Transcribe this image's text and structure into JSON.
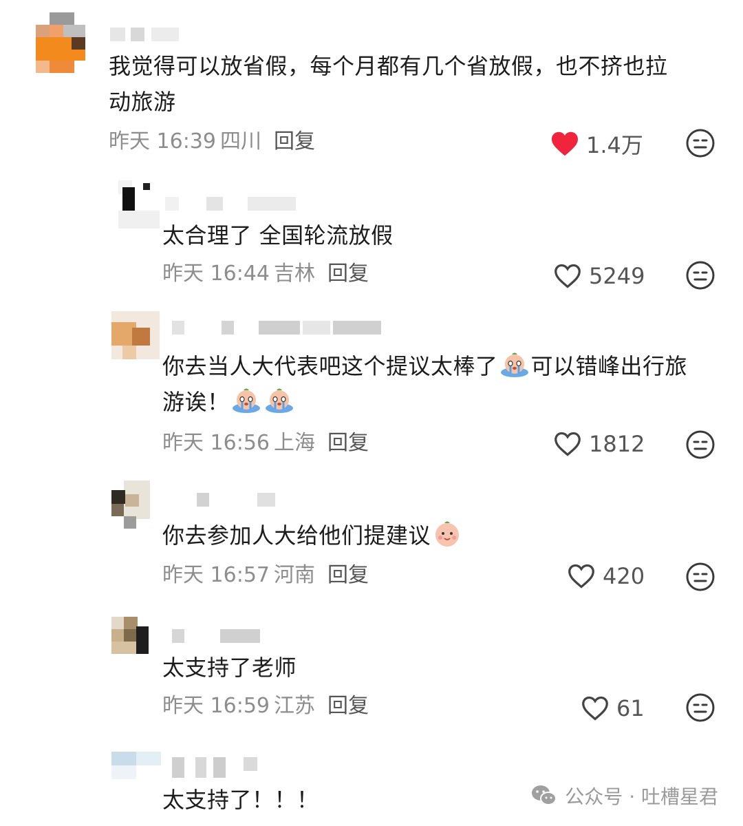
{
  "comments": [
    {
      "text_line1": "我觉得可以放省假，每个月都有几个省放假，也不挤也拉",
      "text_line2": "动旅游",
      "time": "昨天 16:39",
      "location": "四川",
      "reply": "回复",
      "likes": "1.4万",
      "liked": true
    },
    {
      "text_line1": "太合理了 全国轮流放假",
      "time": "昨天 16:44",
      "location": "吉林",
      "reply": "回复",
      "likes": "5249",
      "liked": false
    },
    {
      "text_line1": "你去当人大代表吧这个提议太棒了",
      "text_line1b": "可以错峰出行旅",
      "text_line2": "游诶！",
      "time": "昨天 16:56",
      "location": "上海",
      "reply": "回复",
      "likes": "1812",
      "liked": false
    },
    {
      "text_line1": "你去参加人大给他们提建议",
      "time": "昨天 16:57",
      "location": "河南",
      "reply": "回复",
      "likes": "420",
      "liked": false
    },
    {
      "text_line1": "太支持了老师",
      "time": "昨天 16:59",
      "location": "江苏",
      "reply": "回复",
      "likes": "61",
      "liked": false
    },
    {
      "text_line1": "太支持了！！！"
    }
  ],
  "watermark": {
    "label": "公众号 · 吐槽星君",
    "icon": "wechat-icon"
  },
  "colors": {
    "like_active": "#f0243c",
    "meta_gray": "#8d8d8d"
  }
}
